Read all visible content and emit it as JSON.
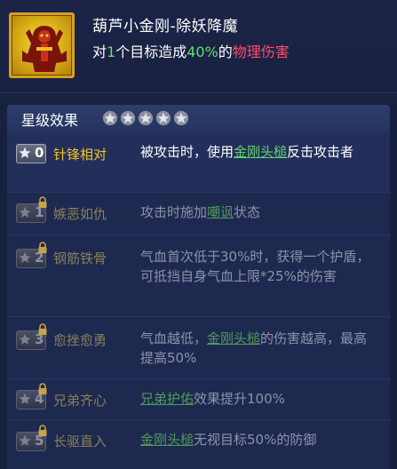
{
  "skill": {
    "name": "葫芦小金刚-除妖降魔",
    "desc_prefix": "对",
    "desc_count": "1",
    "desc_mid": "个目标造成",
    "desc_percent": "40%",
    "desc_of": "的",
    "desc_damage": "物理伤害",
    "icon": "gourd-warrior-icon"
  },
  "section": {
    "title": "星级效果",
    "star_count": 5
  },
  "rows": [
    {
      "level": "0",
      "locked": false,
      "name": "针锋相对",
      "pre": "被攻击时，使用",
      "link": "金刚头槌",
      "post": "反击攻击者"
    },
    {
      "level": "1",
      "locked": true,
      "name": "嫉恶如仇",
      "pre": "攻击时施加",
      "link": "嘲讽",
      "post": "状态"
    },
    {
      "level": "2",
      "locked": true,
      "name": "钢筋铁骨",
      "pre": "气血首次低于30%时，获得一个护盾，可抵挡自身气血上限*25%的伤害",
      "link": "",
      "post": ""
    },
    {
      "level": "3",
      "locked": true,
      "name": "愈挫愈勇",
      "pre": "气血越低，",
      "link": "金刚头槌",
      "post": "的伤害越高，最高提高50%"
    },
    {
      "level": "4",
      "locked": true,
      "name": "兄弟齐心",
      "pre": "",
      "link": "兄弟护佑",
      "post": "效果提升100%"
    },
    {
      "level": "5",
      "locked": true,
      "name": "长驱直入",
      "pre": "",
      "link": "金刚头槌",
      "post": "无视目标50%的防御"
    }
  ],
  "colors": {
    "gold": "#f3c522",
    "green": "#5fe071",
    "red": "#ff4d6a",
    "link_green": "#5fd56f"
  }
}
